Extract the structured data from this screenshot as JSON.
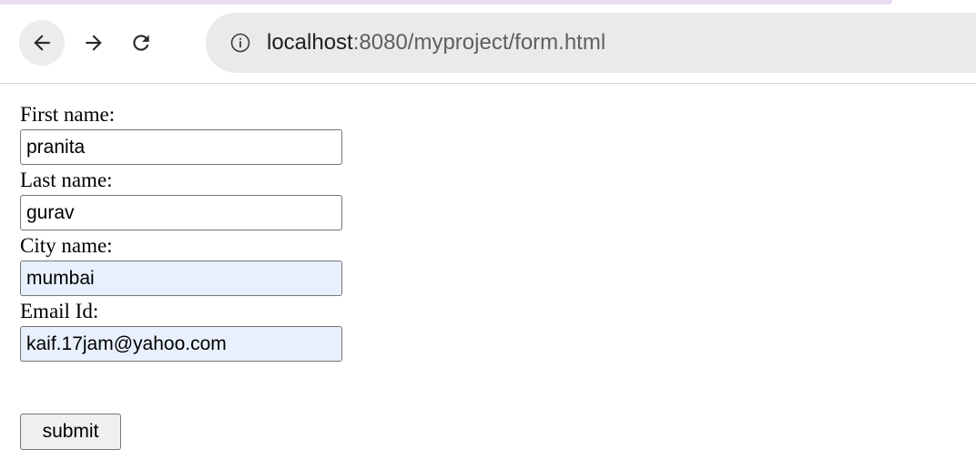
{
  "browser": {
    "url_host": "localhost",
    "url_rest": ":8080/myproject/form.html",
    "icons": {
      "back": "back-arrow-icon",
      "forward": "forward-arrow-icon",
      "reload": "reload-icon",
      "info": "info-icon"
    }
  },
  "form": {
    "fields": [
      {
        "label": "First name:",
        "value": "pranita",
        "autofilled": false
      },
      {
        "label": "Last name:",
        "value": "gurav",
        "autofilled": false
      },
      {
        "label": "City name:",
        "value": "mumbai",
        "autofilled": true
      },
      {
        "label": "Email Id:",
        "value": "kaif.17jam@yahoo.com",
        "autofilled": true
      }
    ],
    "submit_label": "submit"
  },
  "colors": {
    "autofill_background": "#e8f0fe",
    "tab_accent": "#eadcf2",
    "omnibox_background": "#eaeaea"
  }
}
